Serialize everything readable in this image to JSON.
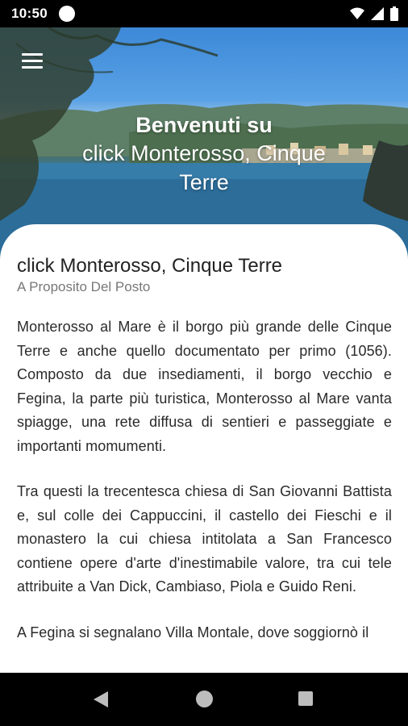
{
  "status_bar": {
    "time": "10:50",
    "icons": [
      "wifi-icon",
      "signal-icon",
      "battery-icon"
    ]
  },
  "hero": {
    "welcome": "Benvenuti su",
    "place": "click Monterosso, Cinque Terre"
  },
  "content": {
    "title": "click Monterosso, Cinque Terre",
    "subtitle": "A Proposito Del Posto",
    "paragraphs": [
      "Monterosso al Mare è il borgo più grande delle Cinque Terre e anche quello documentato per primo (1056). Composto da due insediamenti, il borgo vecchio e Fegina, la parte più turistica, Monterosso al Mare vanta spiagge, una rete diffusa di sentieri e passeggiate e importanti momumenti.",
      "Tra questi la trecentesca chiesa di San Giovanni Battista e, sul colle dei Cappuccini, il castello dei Fieschi e il monastero la cui chiesa intitolata a San Francesco contiene opere d'arte d'inestimabile valore, tra cui tele attribuite a Van Dick, Cambiaso, Piola e Guido Reni.",
      "A Fegina si segnalano Villa Montale, dove soggiornò il"
    ]
  },
  "nav_bar": {
    "icons": [
      "back-icon",
      "home-icon",
      "recents-icon"
    ]
  }
}
